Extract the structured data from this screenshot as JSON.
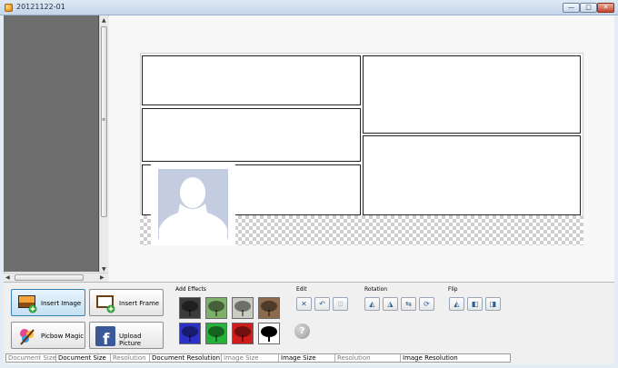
{
  "window": {
    "title": "20121122-01",
    "minimize_glyph": "—",
    "maximize_glyph": "□",
    "close_glyph": "✕"
  },
  "toolbar": {
    "insert_image": "Insert Image",
    "insert_frame": "Insert Frame",
    "picbow_magic": "Picbow Magic",
    "upload_picture": "Upload Picture",
    "add_effects": "Add Effects",
    "edit": "Edit",
    "rotation": "Rotation",
    "flip": "Flip",
    "help_glyph": "?"
  },
  "effects": [
    {
      "name": "effect-charcoal",
      "color": "#3a3a3a"
    },
    {
      "name": "effect-green-tint",
      "color": "#7fb06a"
    },
    {
      "name": "effect-faded",
      "color": "#c8cbc2"
    },
    {
      "name": "effect-sepia",
      "color": "#8c6a4b"
    },
    {
      "name": "effect-blue",
      "color": "#2c32c8"
    },
    {
      "name": "effect-green",
      "color": "#26b23a"
    },
    {
      "name": "effect-red",
      "color": "#d21c1c"
    },
    {
      "name": "effect-silhouette",
      "color": "#ffffff"
    }
  ],
  "edit_buttons": [
    {
      "name": "delete",
      "glyph": "✕",
      "enabled": true
    },
    {
      "name": "undo",
      "glyph": "↶",
      "enabled": true
    },
    {
      "name": "crop",
      "glyph": "⊡",
      "enabled": false
    }
  ],
  "rotation_buttons": [
    {
      "name": "rotate-left",
      "glyph": "◭"
    },
    {
      "name": "rotate-right",
      "glyph": "◮"
    },
    {
      "name": "rotate-90",
      "glyph": "⇆"
    },
    {
      "name": "rotate-free",
      "glyph": "⟳"
    }
  ],
  "flip_buttons": [
    {
      "name": "flip-vertical",
      "glyph": "◭"
    },
    {
      "name": "flip-horizontal-left",
      "glyph": "◧"
    },
    {
      "name": "flip-horizontal-right",
      "glyph": "◨"
    }
  ],
  "statusbar": {
    "doc_size_label": "Document Size",
    "doc_size_value": "Document Size",
    "resolution_label": "Resolution",
    "doc_resolution_value": "Document Resolution",
    "image_size_label": "Image Size",
    "image_size_value": "Image Size",
    "img_resolution_label": "Resolution",
    "img_resolution_value": "Image Resolution"
  }
}
